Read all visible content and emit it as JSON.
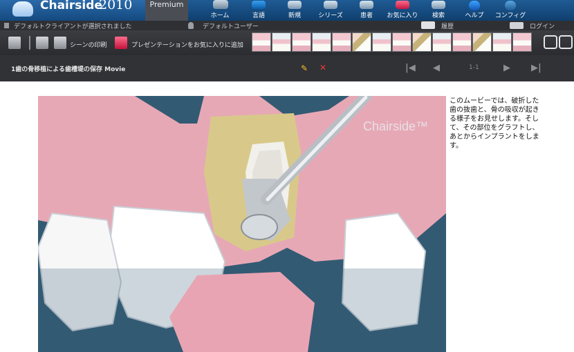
{
  "header": {
    "brand": "Chairside",
    "year": "2010",
    "edition": "Premium",
    "nav": [
      {
        "label": "ホーム",
        "icon": "home-icon"
      },
      {
        "label": "言語",
        "icon": "globe-icon"
      },
      {
        "label": "新規",
        "icon": "new-icon"
      },
      {
        "label": "シリーズ",
        "icon": "film-icon"
      },
      {
        "label": "患者",
        "icon": "patient-icon"
      },
      {
        "label": "お気に入り",
        "icon": "heart-icon"
      },
      {
        "label": "検索",
        "icon": "search-icon"
      },
      {
        "label": "ヘルプ",
        "icon": "help-icon"
      },
      {
        "label": "コンフィグ",
        "icon": "gear-icon"
      }
    ]
  },
  "infobar": {
    "client": "デフォルトクライアントが選択されました",
    "user": "デフォルトユーザー",
    "history": "履歴",
    "login": "ログイン"
  },
  "toolbar": {
    "print": "シーンの印刷",
    "add_favorite": "プレゼンテーションをお気に入りに追加",
    "thumbnail_count": 14
  },
  "scene": {
    "title": "1歯の骨移植による歯槽堤の保存 Movie",
    "pager": "1-1"
  },
  "video": {
    "watermark": "Chairside™"
  },
  "description": "このムービーでは、破折した歯の抜歯と、骨の吸収が起きる様子をお見せします。そして、その部位をグラフトし、あとからインプラントをします。",
  "colors": {
    "header_blue": "#1f5b94",
    "dark_bar": "#313235",
    "gum_pink": "#e6a8b4",
    "bone_yellow": "#d8c98a"
  }
}
